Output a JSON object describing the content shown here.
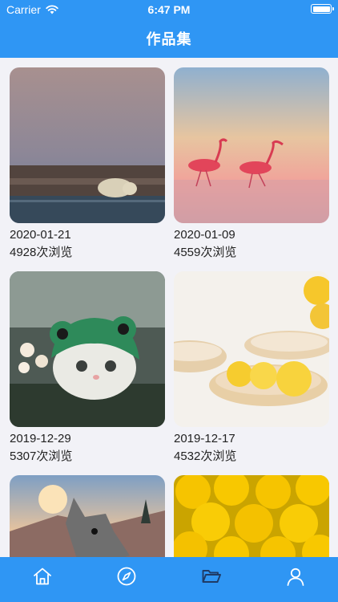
{
  "status_bar": {
    "carrier": "Carrier",
    "time": "6:47 PM"
  },
  "nav": {
    "title": "作品集"
  },
  "gallery": {
    "items": [
      {
        "date": "2020-01-21",
        "views": "4928次浏览",
        "image": "polar-bear-photo"
      },
      {
        "date": "2020-01-09",
        "views": "4559次浏览",
        "image": "flamingos-photo"
      },
      {
        "date": "2019-12-29",
        "views": "5307次浏览",
        "image": "kitten-frog-hat-photo"
      },
      {
        "date": "2019-12-17",
        "views": "4532次浏览",
        "image": "lemon-slices-photo"
      },
      {
        "image": "dog-sunset-photo"
      },
      {
        "image": "yellow-flowers-photo"
      }
    ]
  },
  "tab_bar": {
    "tabs": [
      {
        "icon": "home-icon"
      },
      {
        "icon": "compass-icon"
      },
      {
        "icon": "folder-icon",
        "selected": true
      },
      {
        "icon": "person-icon"
      }
    ]
  },
  "colors": {
    "accent": "#2f96f4",
    "background": "#f2f2f7",
    "text": "#222222"
  }
}
